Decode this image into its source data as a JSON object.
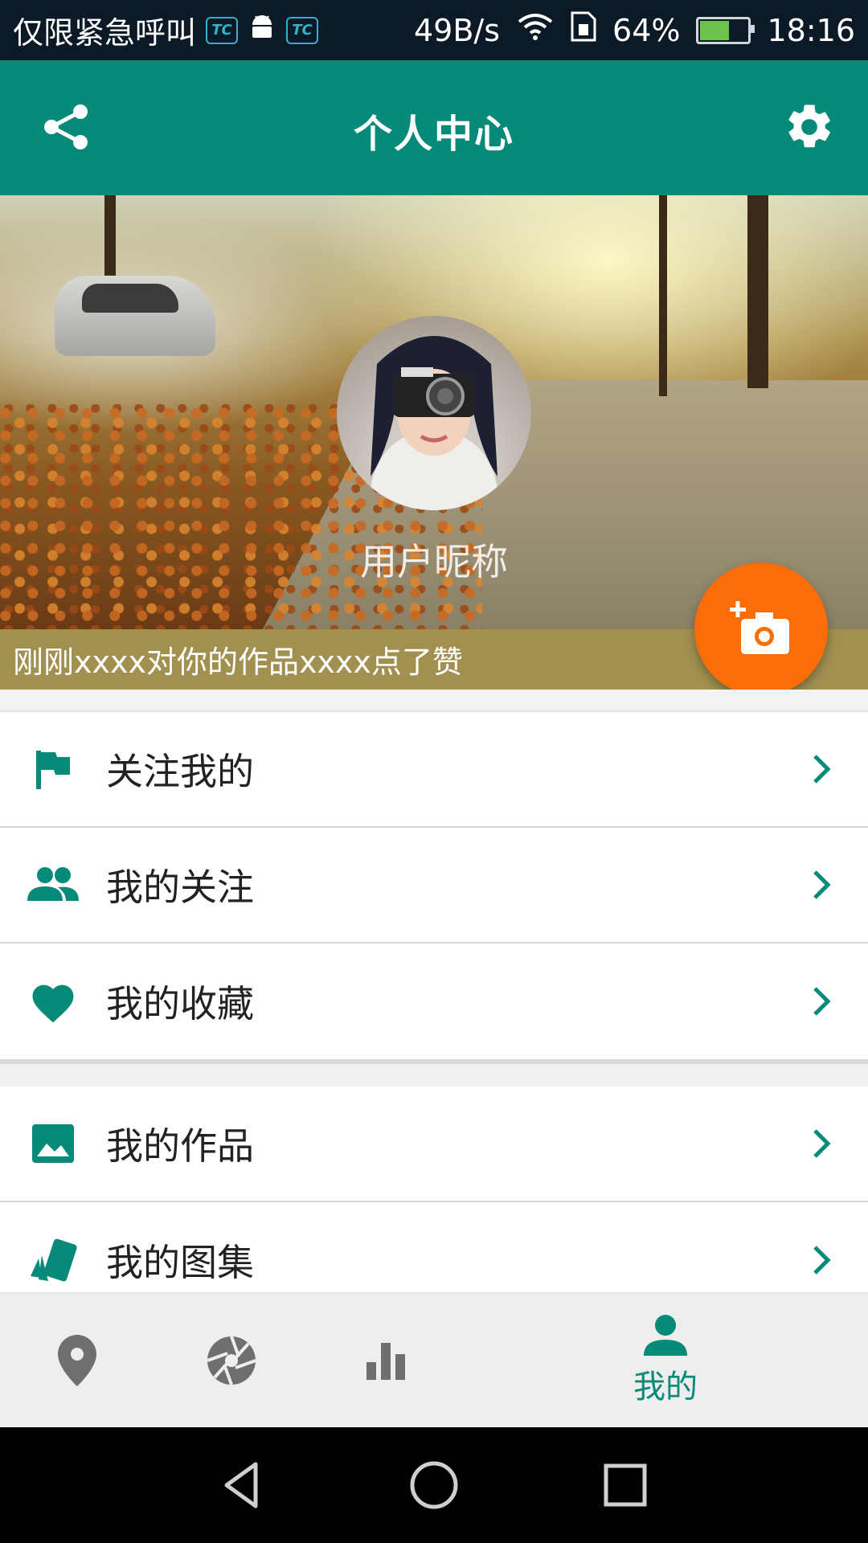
{
  "status_bar": {
    "carrier": "仅限紧急呼叫",
    "speed": "49B/s",
    "battery": "64%",
    "time": "18:16",
    "battery_level": 0.64
  },
  "app_bar": {
    "title": "个人中心",
    "left_icon": "share-icon",
    "right_icon": "gear-icon"
  },
  "profile": {
    "nickname": "用户昵称"
  },
  "notice": {
    "text": "刚刚xxxx对你的作品xxxx点了赞"
  },
  "fab": {
    "icon": "add-photo-icon"
  },
  "menu_group_1": [
    {
      "label": "关注我的",
      "icon": "flag-icon"
    },
    {
      "label": "我的关注",
      "icon": "people-icon"
    },
    {
      "label": "我的收藏",
      "icon": "heart-icon"
    }
  ],
  "menu_group_2": [
    {
      "label": "我的作品",
      "icon": "image-icon"
    },
    {
      "label": "我的图集",
      "icon": "collection-icon"
    }
  ],
  "bottom_nav": {
    "items": [
      {
        "icon": "location-pin-icon"
      },
      {
        "icon": "camera-aperture-icon"
      },
      {
        "icon": "bar-chart-icon"
      },
      {
        "icon": "person-icon",
        "label": "我的",
        "active": true
      }
    ]
  },
  "colors": {
    "primary": "#078a78",
    "accent": "#fa6d08",
    "notice_bg": "#a19050"
  }
}
